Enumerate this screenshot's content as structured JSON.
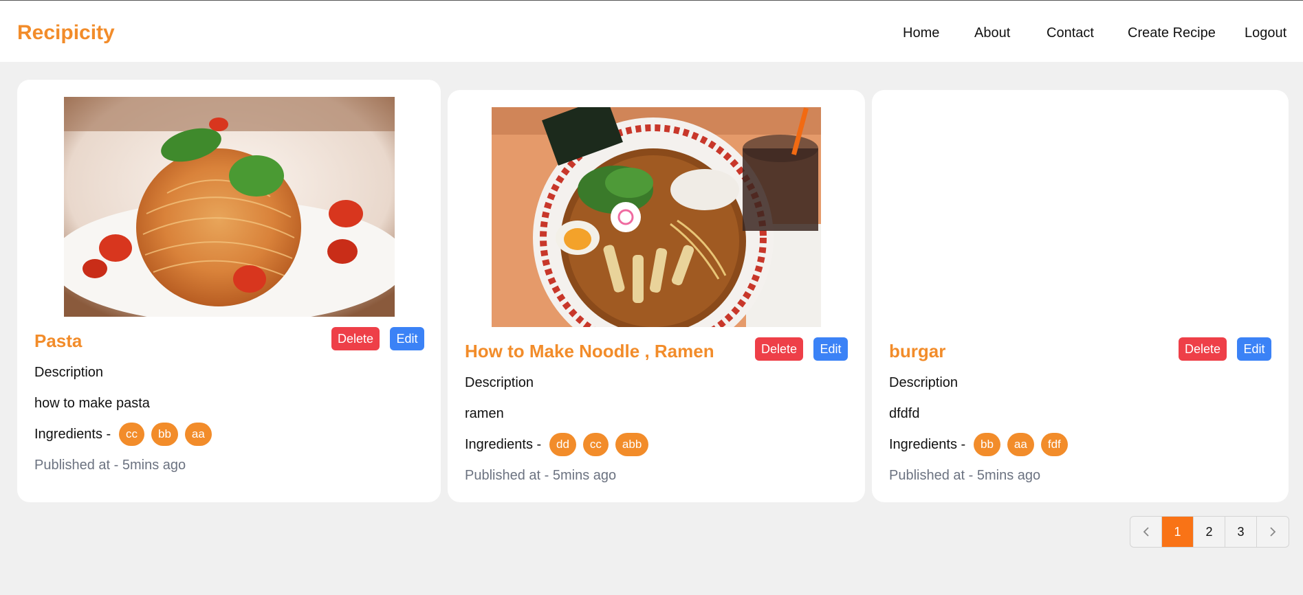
{
  "header": {
    "brand": "Recipicity",
    "nav": [
      "Home",
      "About",
      "Contact",
      "Create Recipe",
      "Logout"
    ]
  },
  "cards": [
    {
      "title": "Pasta",
      "delete_label": "Delete",
      "edit_label": "Edit",
      "description_label": "Description",
      "description": "how to make pasta",
      "ingredients_label": "Ingredients -",
      "ingredients": [
        "cc",
        "bb",
        "aa"
      ],
      "published": "Published at - 5mins ago"
    },
    {
      "title": "How to Make Noodle , Ramen",
      "delete_label": "Delete",
      "edit_label": "Edit",
      "description_label": "Description",
      "description": "ramen",
      "ingredients_label": "Ingredients -",
      "ingredients": [
        "dd",
        "cc",
        "abb"
      ],
      "published": "Published at - 5mins ago"
    },
    {
      "title": "burgar",
      "delete_label": "Delete",
      "edit_label": "Edit",
      "description_label": "Description",
      "description": "dfdfd",
      "ingredients_label": "Ingredients -",
      "ingredients": [
        "bb",
        "aa",
        "fdf"
      ],
      "published": "Published at - 5mins ago"
    }
  ],
  "pagination": {
    "prev_icon": "chevron-left-icon",
    "pages": [
      "1",
      "2",
      "3"
    ],
    "current": "1",
    "next_icon": "chevron-right-icon"
  },
  "colors": {
    "accent": "#f28c2a",
    "delete": "#ee3f48",
    "edit": "#3b82f6",
    "background": "#f0f0f0"
  }
}
